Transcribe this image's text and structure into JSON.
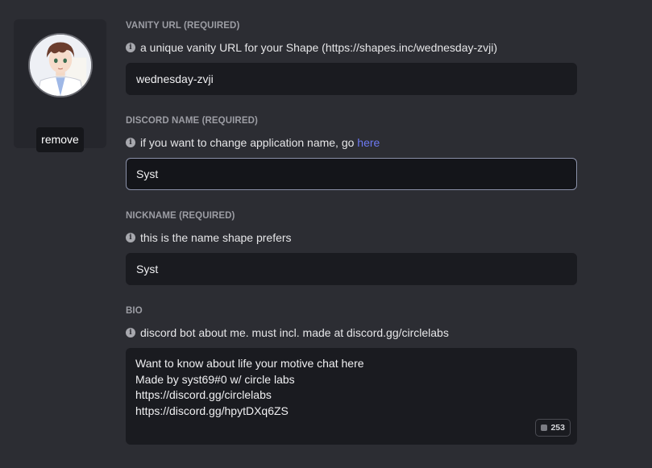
{
  "avatar_card": {
    "remove_label": "remove"
  },
  "fields": {
    "vanity": {
      "label": "VANITY URL (REQUIRED)",
      "hint": "a unique vanity URL for your Shape (https://shapes.inc/wednesday-zvji)",
      "value": "wednesday-zvji"
    },
    "discord_name": {
      "label": "DISCORD NAME (REQUIRED)",
      "hint": "if you want to change application name, go ",
      "hint_link": "here",
      "value": "Syst"
    },
    "nickname": {
      "label": "NICKNAME (REQUIRED)",
      "hint": "this is the name shape prefers",
      "value": "Syst"
    },
    "bio": {
      "label": "BIO",
      "hint": "discord bot about me. must incl. made at discord.gg/circlelabs",
      "lines": [
        "Want to know about life your motive chat here",
        "Made by syst69#0 w/ circle labs",
        "https://discord.gg/circlelabs",
        "https://discord.gg/hpytDXq6ZS"
      ],
      "counter": "253"
    }
  },
  "icons": {
    "info": "info-icon",
    "counter": "character-count-icon"
  },
  "colors": {
    "background": "#2c2d33",
    "input": "#1a1b20",
    "link": "#6c78f0"
  }
}
